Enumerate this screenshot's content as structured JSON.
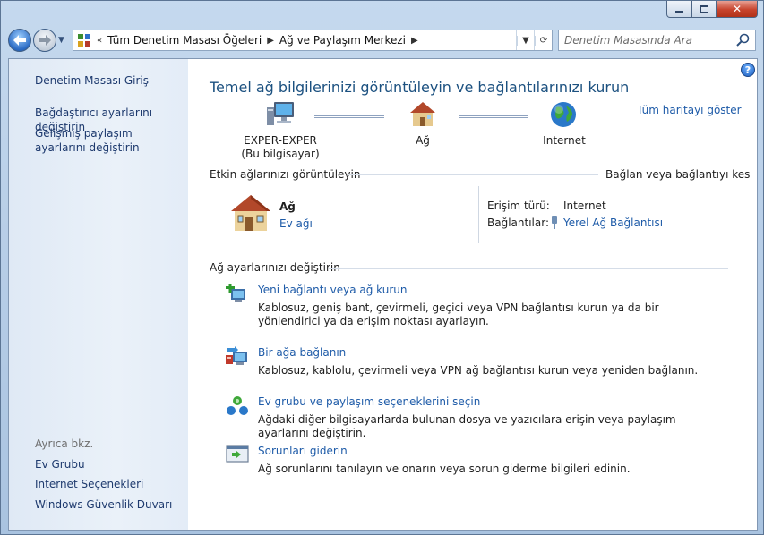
{
  "window": {
    "controls": {
      "minimize_icon": "minimize-icon",
      "maximize_icon": "maximize-icon",
      "close_icon": "close-icon"
    }
  },
  "nav": {
    "breadcrumb_prefix": "«",
    "crumbs": [
      "Tüm Denetim Masası Öğeleri",
      "Ağ ve Paylaşım Merkezi"
    ],
    "search_placeholder": "Denetim Masasında Ara"
  },
  "sidebar": {
    "home": "Denetim Masası Giriş",
    "links": [
      "Bağdaştırıcı ayarlarını değiştirin",
      "Gelişmiş paylaşım ayarlarını değiştirin"
    ],
    "see_also": "Ayrıca bkz.",
    "see_links": [
      "Ev Grubu",
      "Internet Seçenekleri",
      "Windows Güvenlik Duvarı"
    ]
  },
  "main": {
    "title": "Temel ağ bilgilerinizi görüntüleyin ve bağlantılarınızı kurun",
    "map_link": "Tüm haritayı göster",
    "map": {
      "computer": "EXPER-EXPER",
      "computer_sub": "(Bu bilgisayar)",
      "network": "Ağ",
      "internet": "Internet"
    },
    "active": {
      "heading": "Etkin ağlarınızı görüntüleyin",
      "connect_link": "Bağlan veya bağlantıyı kes",
      "network_name": "Ağ",
      "network_type": "Ev ağı",
      "access_label": "Erişim türü:",
      "access_value": "Internet",
      "connections_label": "Bağlantılar:",
      "connections_value": "Yerel Ağ Bağlantısı"
    },
    "settings": {
      "heading": "Ağ ayarlarınızı değiştirin",
      "tasks": [
        {
          "title": "Yeni bağlantı veya ağ kurun",
          "desc": "Kablosuz, geniş bant, çevirmeli, geçici veya VPN bağlantısı kurun ya da bir yönlendirici ya da erişim noktası ayarlayın."
        },
        {
          "title": "Bir ağa bağlanın",
          "desc": "Kablosuz, kablolu, çevirmeli veya VPN ağ bağlantısı kurun veya yeniden bağlanın."
        },
        {
          "title": "Ev grubu ve paylaşım seçeneklerini seçin",
          "desc": "Ağdaki diğer bilgisayarlarda bulunan dosya ve yazıcılara erişin veya paylaşım ayarlarını değiştirin."
        },
        {
          "title": "Sorunları giderin",
          "desc": "Ağ sorunlarını tanılayın ve onarın veya sorun giderme bilgileri edinin."
        }
      ]
    }
  }
}
